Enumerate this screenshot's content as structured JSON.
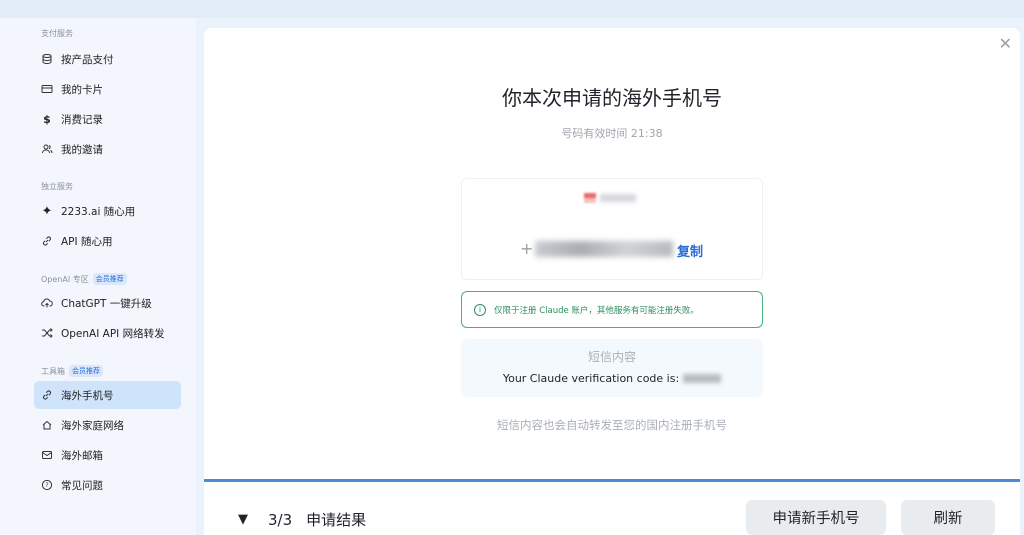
{
  "sidebar": {
    "sections": [
      {
        "title": "支付服务",
        "tag": ""
      },
      {
        "title": "独立服务",
        "tag": ""
      },
      {
        "title": "OpenAI 专区",
        "tag": "会员推荐"
      },
      {
        "title": "工具箱",
        "tag": "会员推荐"
      }
    ],
    "items": [
      {
        "label": "按产品支付",
        "icon": "coins-icon"
      },
      {
        "label": "我的卡片",
        "icon": "card-icon"
      },
      {
        "label": "消费记录",
        "icon": "dollar-icon"
      },
      {
        "label": "我的邀请",
        "icon": "users-icon"
      },
      {
        "label": "2233.ai 随心用",
        "icon": "sparkle-icon"
      },
      {
        "label": "API 随心用",
        "icon": "link-icon"
      },
      {
        "label": "ChatGPT 一键升级",
        "icon": "cloud-upload-icon"
      },
      {
        "label": "OpenAI API 网络转发",
        "icon": "shuffle-icon"
      },
      {
        "label": "海外手机号",
        "icon": "link-icon"
      },
      {
        "label": "海外家庭网络",
        "icon": "home-network-icon"
      },
      {
        "label": "海外邮箱",
        "icon": "mail-icon"
      },
      {
        "label": "常见问题",
        "icon": "help-icon"
      }
    ],
    "active_item": "海外手机号"
  },
  "main": {
    "title": "你本次申请的海外手机号",
    "validity": "号码有效时间 21:38",
    "phone_prefix": "+",
    "copy_label": "复制",
    "notice": "仅限于注册 Claude 账户，其他服务有可能注册失败。",
    "sms_label": "短信内容",
    "sms_text": "Your Claude verification code is:",
    "forward_text": "短信内容也会自动转发至您的国内注册手机号"
  },
  "footer": {
    "step": "3/3",
    "step_title": "申请结果",
    "new_number_button": "申请新手机号",
    "refresh_button": "刷新"
  },
  "colors": {
    "accent": "#2a6bd8",
    "active_bg": "#cfe3fb",
    "notice_green": "#46b37a",
    "divider_blue": "#4a8ad6"
  }
}
